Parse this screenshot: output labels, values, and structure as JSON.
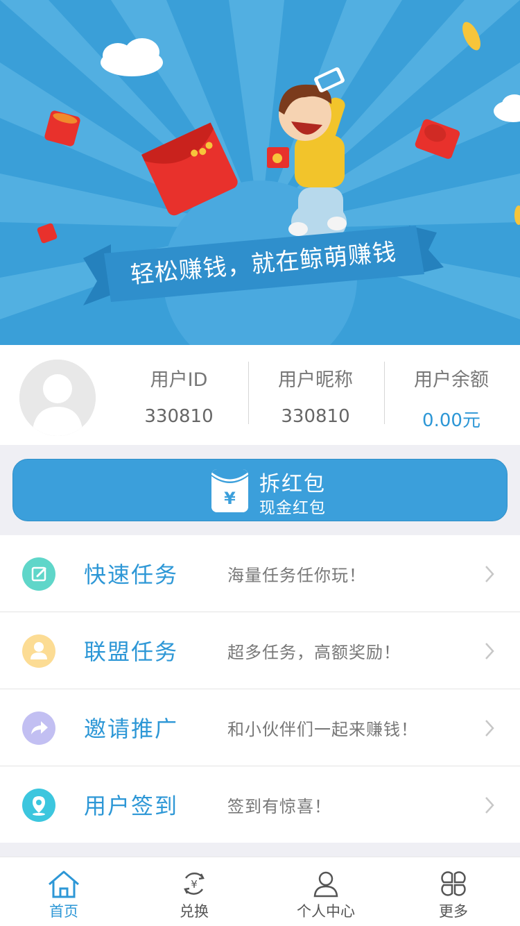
{
  "banner": {
    "slogan": "轻松赚钱，就在鲸萌赚钱"
  },
  "user": {
    "id_label": "用户ID",
    "id_value": "330810",
    "nickname_label": "用户昵称",
    "nickname_value": "330810",
    "balance_label": "用户余额",
    "balance_value": "0.00元"
  },
  "red_packet": {
    "title": "拆红包",
    "subtitle": "现金红包",
    "icon": "yuan-envelope-icon"
  },
  "menu": [
    {
      "title": "快速任务",
      "desc": "海量任务任你玩！",
      "icon": "edit-icon",
      "color": "#5fd6c9"
    },
    {
      "title": "联盟任务",
      "desc": "超多任务，高额奖励！",
      "icon": "user-icon",
      "color": "#fcdc94"
    },
    {
      "title": "邀请推广",
      "desc": "和小伙伴们一起来赚钱！",
      "icon": "share-icon",
      "color": "#c2bff2"
    },
    {
      "title": "用户签到",
      "desc": "签到有惊喜！",
      "icon": "location-icon",
      "color": "#3cc6de"
    }
  ],
  "tabbar": [
    {
      "label": "首页",
      "icon": "home-icon",
      "active": true
    },
    {
      "label": "兑换",
      "icon": "exchange-icon",
      "active": false
    },
    {
      "label": "个人中心",
      "icon": "person-icon",
      "active": false
    },
    {
      "label": "更多",
      "icon": "more-icon",
      "active": false
    }
  ],
  "colors": {
    "accent": "#2d97d6",
    "banner_bg": "#3a9fd8",
    "page_bg": "#efeff4"
  }
}
